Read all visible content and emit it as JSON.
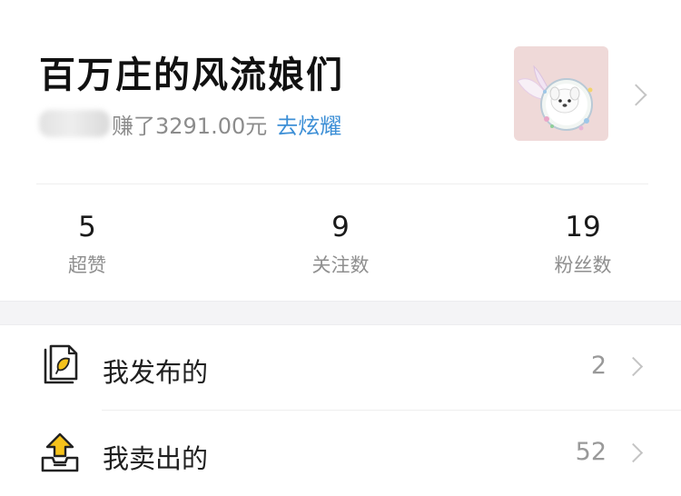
{
  "profile": {
    "username": "百万庄的风流娘们",
    "earnings_text": "赚了3291.00元",
    "brag_link": "去炫耀"
  },
  "stats": [
    {
      "value": "5",
      "label": "超赞"
    },
    {
      "value": "9",
      "label": "关注数"
    },
    {
      "value": "19",
      "label": "粉丝数"
    }
  ],
  "menu": [
    {
      "label": "我发布的",
      "count": "2",
      "icon": "document-leaf-icon"
    },
    {
      "label": "我卖出的",
      "count": "52",
      "icon": "sell-upload-tray-icon"
    }
  ],
  "colors": {
    "link": "#3d8fd6",
    "icon_accent": "#f5c21b",
    "avatar_bg": "#efd9d8"
  }
}
